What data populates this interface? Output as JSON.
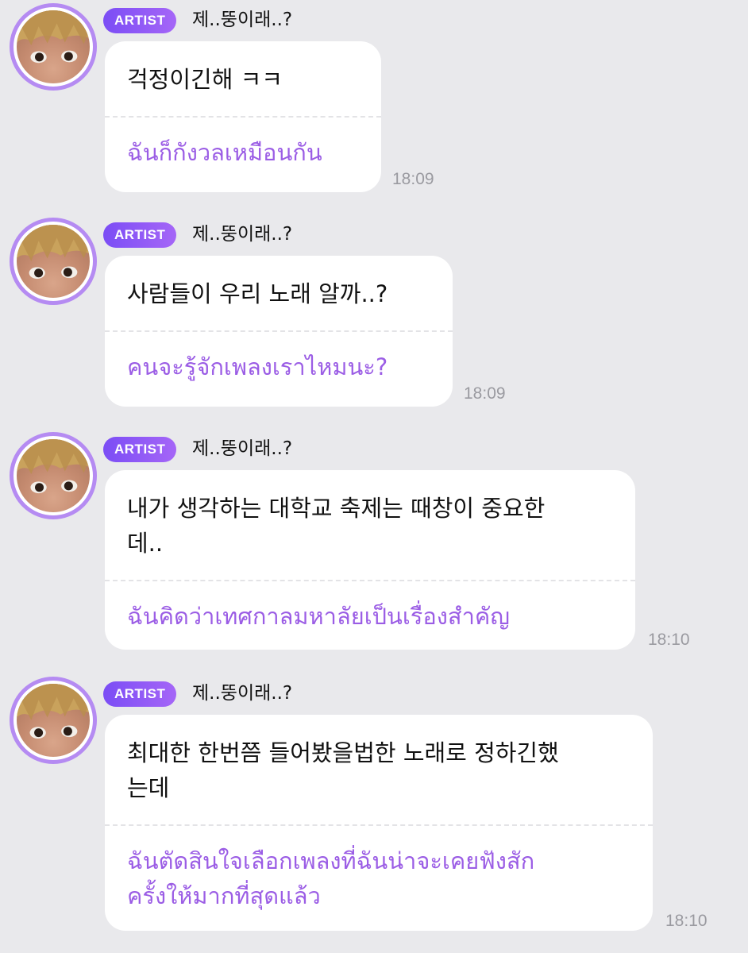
{
  "messages": [
    {
      "badge": "ARTIST",
      "sender": "제..뚱이래..?",
      "original": "걱정이긴해 ㅋㅋ",
      "translation": "ฉันก็กังวลเหมือนกัน",
      "time": "18:09"
    },
    {
      "badge": "ARTIST",
      "sender": "제..뚱이래..?",
      "original": "사람들이 우리 노래 알까..?",
      "translation": "คนจะรู้จักเพลงเราไหมนะ?",
      "time": "18:09"
    },
    {
      "badge": "ARTIST",
      "sender": "제..뚱이래..?",
      "original": "내가 생각하는 대학교 축제는 때창이 중요한\n데..",
      "translation": "ฉันคิดว่าเทศกาลมหาลัยเป็นเรื่องสำคัญ",
      "time": "18:10"
    },
    {
      "badge": "ARTIST",
      "sender": "제..뚱이래..?",
      "original": "최대한 한번쯤 들어봤을법한 노래로 정하긴했\n는데",
      "translation": "ฉันตัดสินใจเลือกเพลงที่ฉันน่าจะเคยฟังสัก\nครั้งให้มากที่สุดแล้ว",
      "time": "18:10"
    }
  ],
  "colors": {
    "background": "#e9e9ec",
    "bubble": "#ffffff",
    "translation_text": "#9b5de5",
    "badge_start": "#7b4df5",
    "badge_end": "#a566f7",
    "avatar_ring": "#b58bf2",
    "timestamp": "#9a9aa0"
  },
  "icons": {
    "avatar": "artist-avatar"
  }
}
